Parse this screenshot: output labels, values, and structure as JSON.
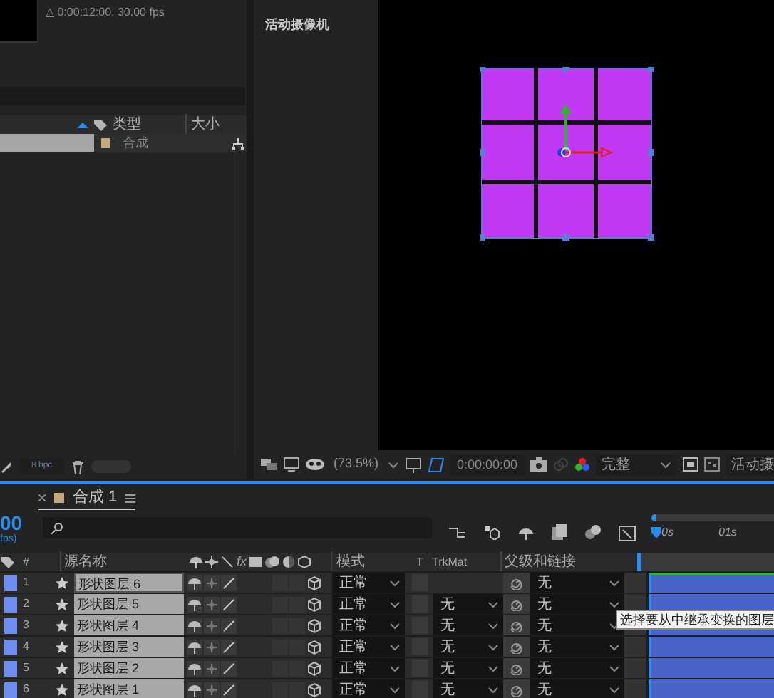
{
  "project": {
    "info": "△ 0:00:12:00, 30.00 fps",
    "columns": [
      {
        "label": "类型"
      },
      {
        "label": "大小"
      }
    ],
    "items": [
      {
        "type": "合成",
        "selected": true,
        "color": "#c4a97a"
      }
    ],
    "bpc": "8 bpc"
  },
  "viewer": {
    "title": "活动摄像机",
    "zoom": "(73.5%)",
    "timecode": "0:00:00:00",
    "resolution": "完整",
    "view": "活动摄"
  },
  "timeline": {
    "tab": {
      "label": "合成 1",
      "color": "#c4a97a"
    },
    "time": "00",
    "fps": "fps)",
    "columns": {
      "number": "#",
      "name": "源名称",
      "effects": "fx",
      "mode": "模式",
      "t": "T",
      "trkmat": "TrkMat",
      "parent": "父级和链接"
    },
    "ruler": [
      "0s",
      "01s"
    ],
    "layers": [
      {
        "number": "1",
        "name": "形状图层 6",
        "color": "#6e8df0",
        "mode": "正常",
        "parent": "无",
        "selected": true
      },
      {
        "number": "2",
        "name": "形状图层 5",
        "color": "#6e8df0",
        "mode": "正常",
        "trkmat": "无",
        "parent": "无",
        "selected": false
      },
      {
        "number": "3",
        "name": "形状图层 4",
        "color": "#6e8df0",
        "mode": "正常",
        "trkmat": "无",
        "parent": "无",
        "selected": false
      },
      {
        "number": "4",
        "name": "形状图层 3",
        "color": "#6e8df0",
        "mode": "正常",
        "trkmat": "无",
        "parent": "无",
        "selected": false
      },
      {
        "number": "5",
        "name": "形状图层 2",
        "color": "#6e8df0",
        "mode": "正常",
        "trkmat": "无",
        "parent": "无",
        "selected": false
      },
      {
        "number": "6",
        "name": "形状图层 1",
        "color": "#6e8df0",
        "mode": "正常",
        "trkmat": "无",
        "parent": "无",
        "selected": false
      }
    ],
    "tooltip": "选择要从中继承变换的图层"
  }
}
